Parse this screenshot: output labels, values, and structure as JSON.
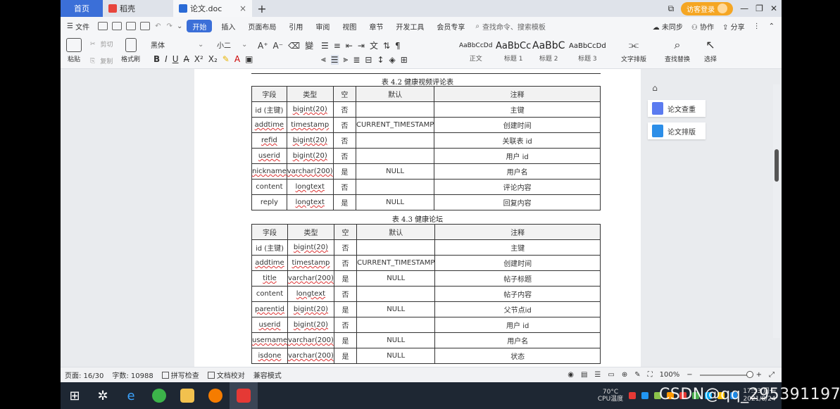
{
  "titlebar": {
    "home_tab": "首页",
    "daoke_tab": "稻壳",
    "doc_tab": "论文.doc",
    "login": "访客登录"
  },
  "menubar": {
    "file": "文件",
    "start": "开始",
    "items": [
      "插入",
      "页面布局",
      "引用",
      "审阅",
      "视图",
      "章节",
      "开发工具",
      "会员专享"
    ],
    "search": "查找命令、搜索模板",
    "sync": "未同步",
    "collab": "协作",
    "share": "分享"
  },
  "ribbon": {
    "paste": "粘贴",
    "cut": "剪切",
    "copy": "复制",
    "format_painter": "格式刷",
    "font_name": "黑体",
    "font_size": "小二",
    "styles": [
      {
        "sample": "AaBbCcDd",
        "name": "正文"
      },
      {
        "sample": "AaBbCc",
        "name": "标题 1"
      },
      {
        "sample": "AaBbC",
        "name": "标题 2"
      },
      {
        "sample": "AaBbCcDd",
        "name": "标题 3"
      }
    ],
    "text_layout": "文字排版",
    "find_replace": "查找替换",
    "select": "选择"
  },
  "document": {
    "table1": {
      "caption": "表 4.2 健康视频评论表",
      "headers": [
        "字段",
        "类型",
        "空",
        "默认",
        "注释"
      ],
      "rows": [
        [
          "id (主键)",
          "bigint(20)",
          "否",
          "",
          "主键"
        ],
        [
          "addtime",
          "timestamp",
          "否",
          "CURRENT_TIMESTAMP",
          "创建时间"
        ],
        [
          "refid",
          "bigint(20)",
          "否",
          "",
          "关联表 id"
        ],
        [
          "userid",
          "bigint(20)",
          "否",
          "",
          "用户 id"
        ],
        [
          "nickname",
          "varchar(200)",
          "是",
          "NULL",
          "用户名"
        ],
        [
          "content",
          "longtext",
          "否",
          "",
          "评论内容"
        ],
        [
          "reply",
          "longtext",
          "是",
          "NULL",
          "回复内容"
        ]
      ]
    },
    "table2": {
      "caption": "表 4.3 健康论坛",
      "headers": [
        "字段",
        "类型",
        "空",
        "默认",
        "注释"
      ],
      "rows": [
        [
          "id (主键)",
          "bigint(20)",
          "否",
          "",
          "主键"
        ],
        [
          "addtime",
          "timestamp",
          "否",
          "CURRENT_TIMESTAMP",
          "创建时间"
        ],
        [
          "title",
          "varchar(200)",
          "是",
          "NULL",
          "帖子标题"
        ],
        [
          "content",
          "longtext",
          "否",
          "",
          "帖子内容"
        ],
        [
          "parentid",
          "bigint(20)",
          "是",
          "NULL",
          "父节点id"
        ],
        [
          "userid",
          "bigint(20)",
          "否",
          "",
          "用户 id"
        ],
        [
          "username",
          "varchar(200)",
          "是",
          "NULL",
          "用户名"
        ],
        [
          "isdone",
          "varchar(200)",
          "是",
          "NULL",
          "状态"
        ]
      ]
    }
  },
  "side_panel": {
    "check": "论文查重",
    "format": "论文排版"
  },
  "statusbar": {
    "page": "页面: 16/30",
    "words": "字数: 10988",
    "spell": "拼写检查",
    "proof": "文档校对",
    "compat": "兼容模式",
    "zoom": "100%",
    "zoom_level": 1.0
  },
  "taskbar": {
    "weather_temp": "70°C",
    "weather_label": "CPU温度",
    "time": "17:53 周一",
    "date": "2021/8/24"
  },
  "watermark": "CSDN@qq_295391197",
  "colors": {
    "accent": "#3b6fd8",
    "login": "#f5a623",
    "taskbar": "#1e2733"
  }
}
